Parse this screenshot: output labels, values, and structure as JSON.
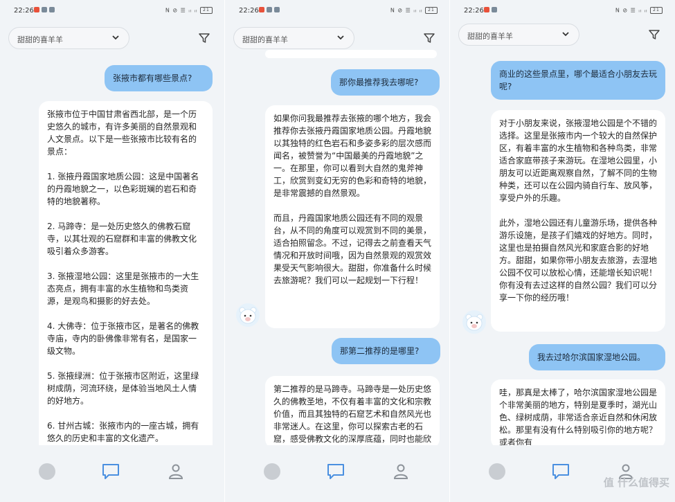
{
  "status_bar": {
    "time": "22:26",
    "indicators": "N ⊘ ☰ ᵢₗ ᵢₗ",
    "battery": "21"
  },
  "header": {
    "selector_value": "甜甜的喜羊羊",
    "icons": [
      "chevron-down-icon",
      "filter-icon"
    ]
  },
  "colors": {
    "user_bubble": "#8ec4f4",
    "bot_bubble": "#ffffff",
    "background": "#f1f4f7",
    "active_tab": "#4a8fe0"
  },
  "panels": [
    {
      "messages": [
        {
          "role": "user",
          "text": "张掖市都有哪些景点?"
        },
        {
          "role": "bot",
          "text": "张掖市位于中国甘肃省西北部，是一个历史悠久的城市，有许多美丽的自然景观和人文景点。以下是一些张掖市比较有名的景点：\n\n1. 张掖丹霞国家地质公园：这是中国著名的丹霞地貌之一，以色彩斑斓的岩石和奇特的地貌著称。\n\n2. 马蹄寺：是一处历史悠久的佛教石窟寺，以其壮观的石窟群和丰富的佛教文化吸引着众多游客。\n\n3. 张掖湿地公园：这里是张掖市的一大生态亮点，拥有丰富的水生植物和鸟类资源，是观鸟和摄影的好去处。\n\n4. 大佛寺：位于张掖市区，是著名的佛教寺庙，寺内的卧佛像非常有名，是国家一级文物。\n\n5. 张掖绿洲：位于张掖市区附近，这里绿树成荫，河流环绕，是体验当地风土人情的好地方。\n\n6. 甘州古城：张掖市内的一座古城，拥有悠久的历史和丰富的文化遗产。"
        }
      ]
    },
    {
      "messages": [
        {
          "role": "user",
          "text": "那你最推荐我去哪呢?"
        },
        {
          "role": "bot",
          "text": "如果你问我最推荐去张掖的哪个地方，我会推荐你去张掖丹霞国家地质公园。丹霞地貌以其独特的红色岩石和多姿多彩的层次感而闻名，被赞誉为“中国最美的丹霞地貌”之一。在那里，你可以看到大自然的鬼斧神工，欣赏到变幻无穷的色彩和奇特的地貌，是非常震撼的自然景观。\n\n而且，丹霞国家地质公园还有不同的观景台，从不同的角度可以观赏到不同的美景，适合拍照留念。不过，记得去之前查看天气情况和开放时间哦，因为自然景观的观赏效果受天气影响很大。甜甜，你准备什么时候去旅游呢？我们可以一起规划一下行程！"
        },
        {
          "role": "user",
          "text": "那第二推荐的是哪里?"
        },
        {
          "role": "bot",
          "text": "第二推荐的是马蹄寺。马蹄寺是一处历史悠久的佛教圣地，不仅有着丰富的文化和宗教价值，而且其独特的石窟艺术和自然风光也非常迷人。在这里，你可以探索古老的石窟，感受佛教文化的深厚底蕴，同时也能欣赏到"
        }
      ]
    },
    {
      "messages": [
        {
          "role": "user",
          "text": "商业的这些景点里，哪个最适合小朋友去玩呢?"
        },
        {
          "role": "bot",
          "text": "对于小朋友来说，张掖湿地公园是个不错的选择。这里是张掖市内一个较大的自然保护区，有着丰富的水生植物和各种鸟类，非常适合家庭带孩子来游玩。在湿地公园里，小朋友可以近距离观察自然，了解不同的生物种类，还可以在公园内骑自行车、放风筝，享受户外的乐趣。\n\n此外，湿地公园还有儿童游乐场，提供各种游乐设施，是孩子们嬉戏的好地方。同时，这里也是拍摄自然风光和家庭合影的好地方。甜甜，如果你带小朋友去旅游，去湿地公园不仅可以放松心情，还能增长知识呢！你有没有去过这样的自然公园？我们可以分享一下你的经历哦！"
        },
        {
          "role": "user",
          "text": "我去过哈尔滨国家湿地公园。"
        },
        {
          "role": "bot",
          "text": "哇，那真是太棒了，哈尔滨国家湿地公园是个非常美丽的地方，特别是夏季时，湖光山色、绿树成荫，非常适合亲近自然和休闲放松。那里有没有什么特别吸引你的地方呢？或者你有"
        }
      ]
    }
  ],
  "tabbar": {
    "tabs": [
      "home-tab",
      "chat-tab",
      "profile-tab"
    ]
  },
  "watermark": "值 什么值得买"
}
